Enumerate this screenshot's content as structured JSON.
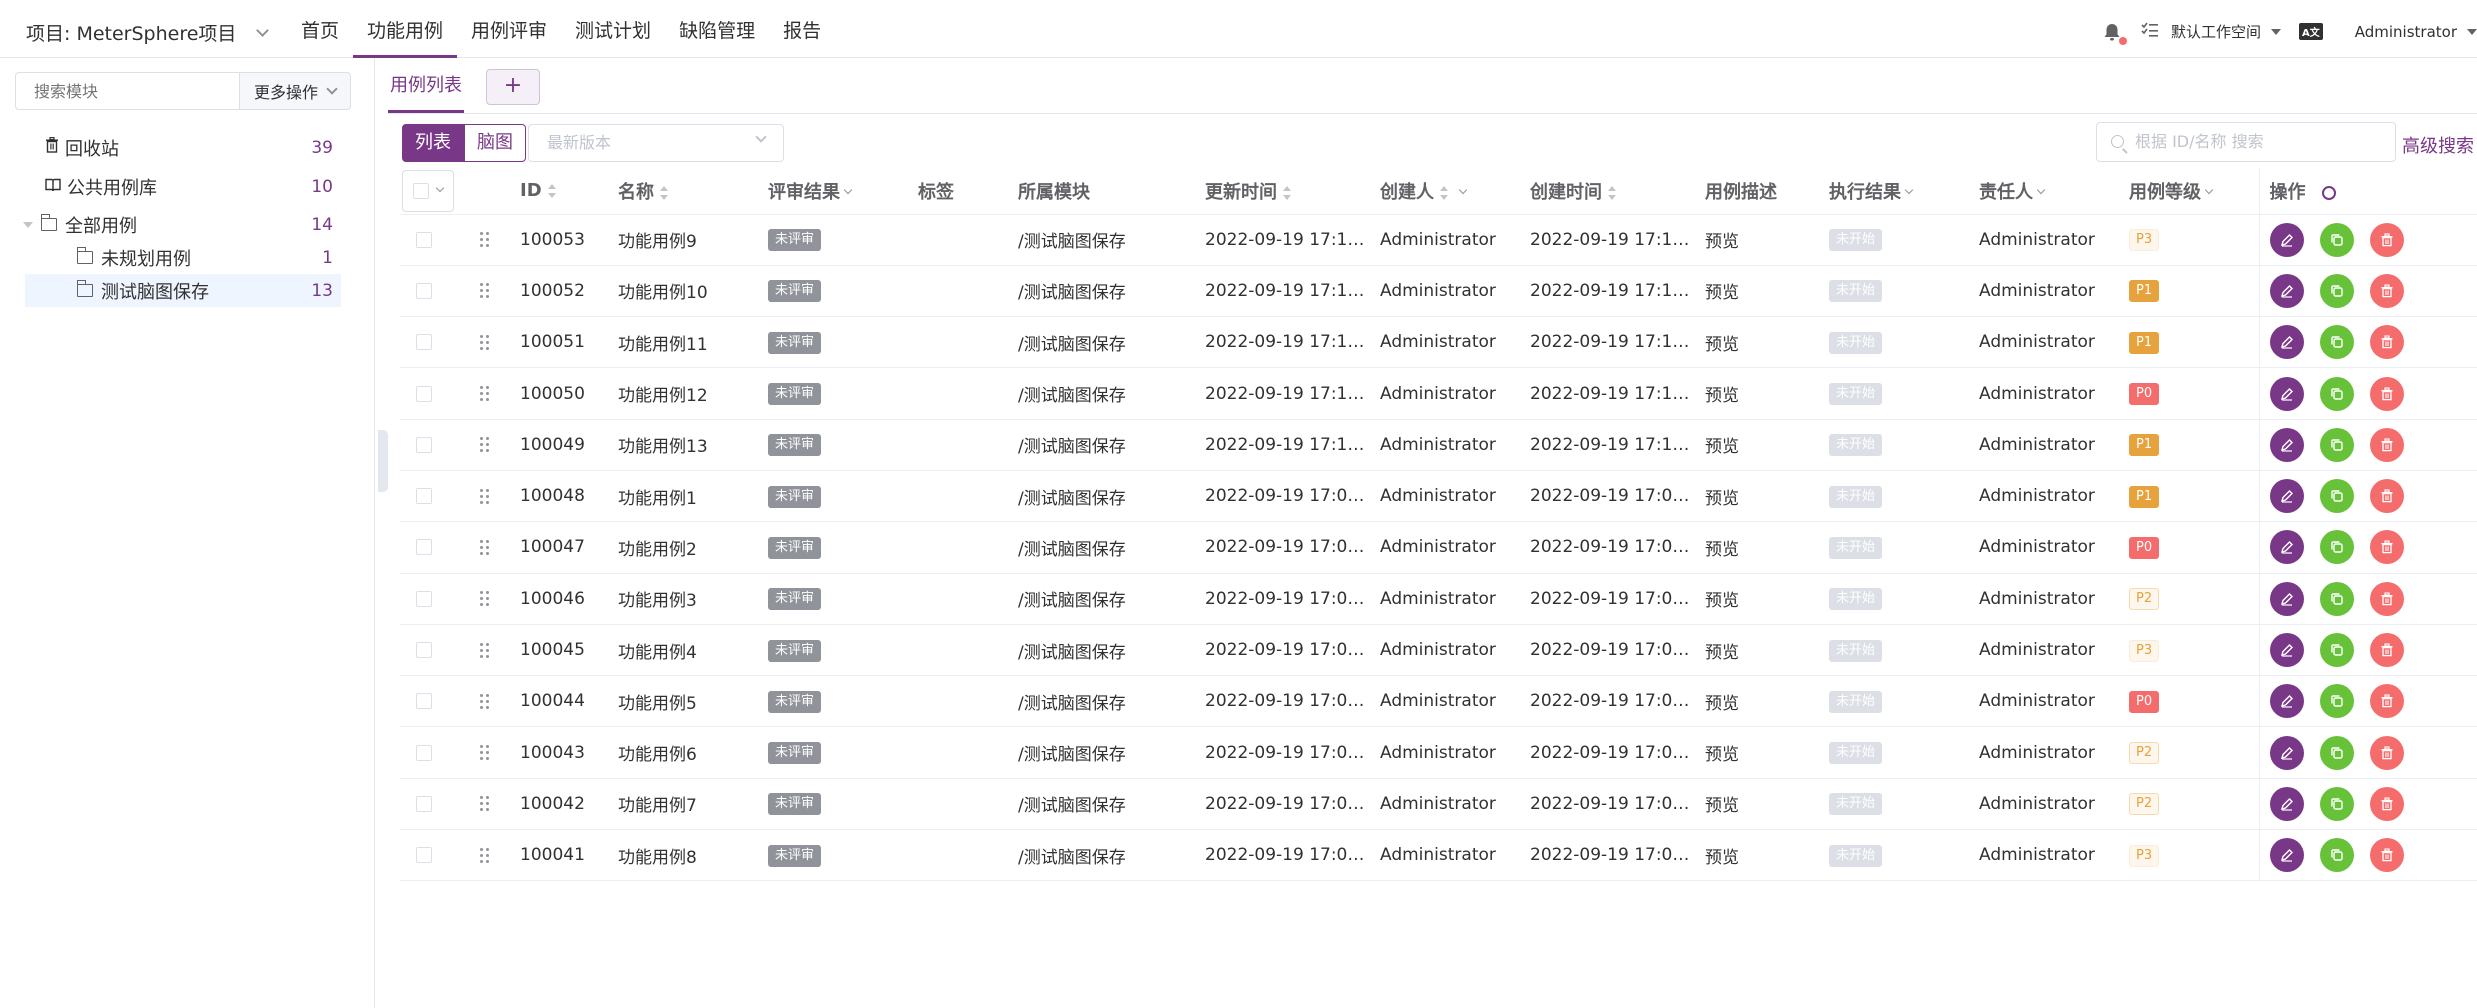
{
  "header": {
    "project_label": "项目: MeterSphere项目",
    "nav": [
      {
        "label": "首页",
        "active": false
      },
      {
        "label": "功能用例",
        "active": true
      },
      {
        "label": "用例评审",
        "active": false
      },
      {
        "label": "测试计划",
        "active": false
      },
      {
        "label": "缺陷管理",
        "active": false
      },
      {
        "label": "报告",
        "active": false
      }
    ],
    "workspace_label": "默认工作空间",
    "lang_icon_text": "A文",
    "user_label": "Administrator"
  },
  "sidebar": {
    "search_placeholder": "搜索模块",
    "more_actions_label": "更多操作",
    "items": [
      {
        "label": "回收站",
        "count": "39",
        "icon": "trash-icon"
      },
      {
        "label": "公共用例库",
        "count": "10",
        "icon": "book-icon"
      },
      {
        "label": "全部用例",
        "count": "14",
        "icon": "folder-icon"
      },
      {
        "label": "未规划用例",
        "count": "1",
        "icon": "folder-icon"
      },
      {
        "label": "测试脑图保存",
        "count": "13",
        "icon": "folder-icon"
      }
    ]
  },
  "main": {
    "tab_label": "用例列表",
    "tab_add_label": "+",
    "view_list_label": "列表",
    "view_mind_label": "脑图",
    "version_placeholder": "最新版本",
    "search_placeholder": "根据 ID/名称 搜索",
    "advanced_search_label": "高级搜索"
  },
  "table": {
    "columns": {
      "id": "ID",
      "name": "名称",
      "review": "评审结果",
      "tags": "标签",
      "module": "所属模块",
      "updated": "更新时间",
      "creator": "创建人",
      "created": "创建时间",
      "desc": "用例描述",
      "exec": "执行结果",
      "owner": "责任人",
      "level": "用例等级",
      "ops": "操作"
    },
    "rows": [
      {
        "id": "100053",
        "name": "功能用例9",
        "review": "未评审",
        "module": "/测试脑图保存",
        "updated": "2022-09-19 17:1…",
        "creator": "Administrator",
        "created": "2022-09-19 17:1…",
        "desc": "预览",
        "exec": "未开始",
        "owner": "Administrator",
        "level": "P3"
      },
      {
        "id": "100052",
        "name": "功能用例10",
        "review": "未评审",
        "module": "/测试脑图保存",
        "updated": "2022-09-19 17:1…",
        "creator": "Administrator",
        "created": "2022-09-19 17:1…",
        "desc": "预览",
        "exec": "未开始",
        "owner": "Administrator",
        "level": "P1"
      },
      {
        "id": "100051",
        "name": "功能用例11",
        "review": "未评审",
        "module": "/测试脑图保存",
        "updated": "2022-09-19 17:1…",
        "creator": "Administrator",
        "created": "2022-09-19 17:1…",
        "desc": "预览",
        "exec": "未开始",
        "owner": "Administrator",
        "level": "P1"
      },
      {
        "id": "100050",
        "name": "功能用例12",
        "review": "未评审",
        "module": "/测试脑图保存",
        "updated": "2022-09-19 17:1…",
        "creator": "Administrator",
        "created": "2022-09-19 17:1…",
        "desc": "预览",
        "exec": "未开始",
        "owner": "Administrator",
        "level": "P0"
      },
      {
        "id": "100049",
        "name": "功能用例13",
        "review": "未评审",
        "module": "/测试脑图保存",
        "updated": "2022-09-19 17:1…",
        "creator": "Administrator",
        "created": "2022-09-19 17:1…",
        "desc": "预览",
        "exec": "未开始",
        "owner": "Administrator",
        "level": "P1"
      },
      {
        "id": "100048",
        "name": "功能用例1",
        "review": "未评审",
        "module": "/测试脑图保存",
        "updated": "2022-09-19 17:0…",
        "creator": "Administrator",
        "created": "2022-09-19 17:0…",
        "desc": "预览",
        "exec": "未开始",
        "owner": "Administrator",
        "level": "P1"
      },
      {
        "id": "100047",
        "name": "功能用例2",
        "review": "未评审",
        "module": "/测试脑图保存",
        "updated": "2022-09-19 17:0…",
        "creator": "Administrator",
        "created": "2022-09-19 17:0…",
        "desc": "预览",
        "exec": "未开始",
        "owner": "Administrator",
        "level": "P0"
      },
      {
        "id": "100046",
        "name": "功能用例3",
        "review": "未评审",
        "module": "/测试脑图保存",
        "updated": "2022-09-19 17:0…",
        "creator": "Administrator",
        "created": "2022-09-19 17:0…",
        "desc": "预览",
        "exec": "未开始",
        "owner": "Administrator",
        "level": "P2"
      },
      {
        "id": "100045",
        "name": "功能用例4",
        "review": "未评审",
        "module": "/测试脑图保存",
        "updated": "2022-09-19 17:0…",
        "creator": "Administrator",
        "created": "2022-09-19 17:0…",
        "desc": "预览",
        "exec": "未开始",
        "owner": "Administrator",
        "level": "P3"
      },
      {
        "id": "100044",
        "name": "功能用例5",
        "review": "未评审",
        "module": "/测试脑图保存",
        "updated": "2022-09-19 17:0…",
        "creator": "Administrator",
        "created": "2022-09-19 17:0…",
        "desc": "预览",
        "exec": "未开始",
        "owner": "Administrator",
        "level": "P0"
      },
      {
        "id": "100043",
        "name": "功能用例6",
        "review": "未评审",
        "module": "/测试脑图保存",
        "updated": "2022-09-19 17:0…",
        "creator": "Administrator",
        "created": "2022-09-19 17:0…",
        "desc": "预览",
        "exec": "未开始",
        "owner": "Administrator",
        "level": "P2"
      },
      {
        "id": "100042",
        "name": "功能用例7",
        "review": "未评审",
        "module": "/测试脑图保存",
        "updated": "2022-09-19 17:0…",
        "creator": "Administrator",
        "created": "2022-09-19 17:0…",
        "desc": "预览",
        "exec": "未开始",
        "owner": "Administrator",
        "level": "P2"
      },
      {
        "id": "100041",
        "name": "功能用例8",
        "review": "未评审",
        "module": "/测试脑图保存",
        "updated": "2022-09-19 17:0…",
        "creator": "Administrator",
        "created": "2022-09-19 17:0…",
        "desc": "预览",
        "exec": "未开始",
        "owner": "Administrator",
        "level": "P3"
      }
    ]
  },
  "colors": {
    "brand": "#783887",
    "success": "#67c23a",
    "danger": "#f56c6c",
    "warning": "#e6a23c"
  }
}
